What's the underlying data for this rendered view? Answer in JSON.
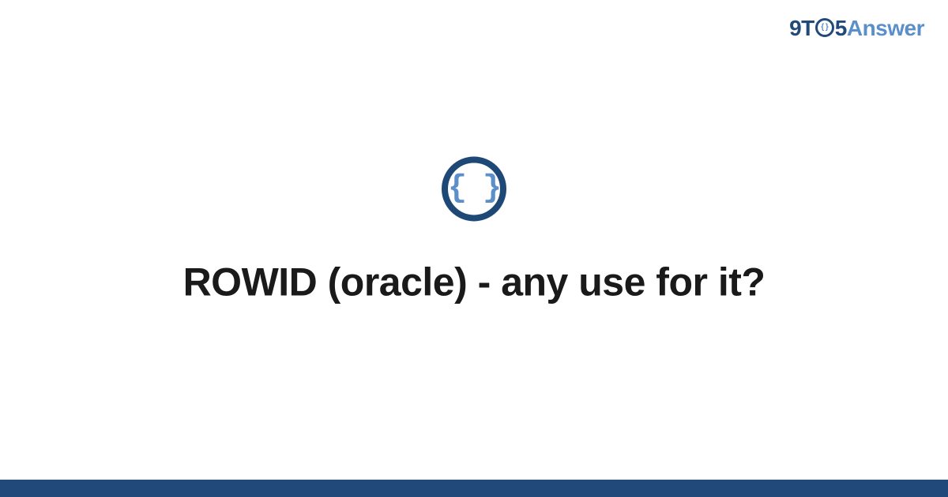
{
  "header": {
    "logo": {
      "part1": "9T",
      "o_inner": "{ }",
      "part2": "5",
      "part3": "Answer"
    }
  },
  "main": {
    "icon_glyph": "{ }",
    "title": "ROWID (oracle) - any use for it?"
  },
  "colors": {
    "primary_dark": "#214a7a",
    "primary_light": "#5a8fc9",
    "text": "#1a1a1a",
    "background": "#ffffff"
  }
}
